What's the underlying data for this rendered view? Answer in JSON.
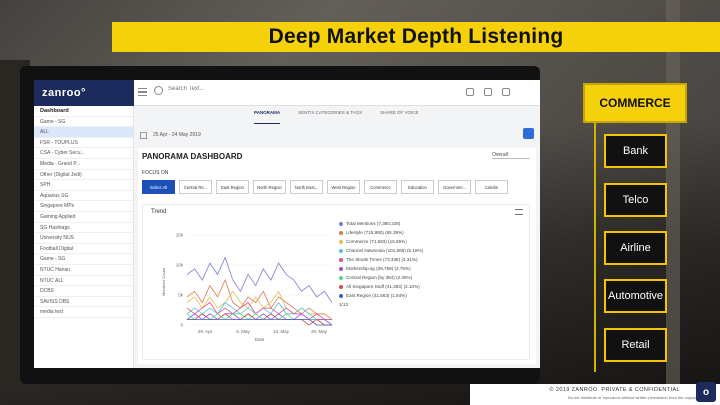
{
  "slide_title": "Deep Market Depth Listening",
  "app": {
    "logo": "zanroo°",
    "search_placeholder": "Search Text...",
    "sidebar": [
      {
        "label": "Dashboard",
        "head": true
      },
      {
        "label": "Game - SG"
      },
      {
        "label": "ALL",
        "active": true
      },
      {
        "label": "FSR - TOUPLUS"
      },
      {
        "label": "CSA - Cyber Secu..."
      },
      {
        "label": "Media - Grand P..."
      },
      {
        "label": "Other (Digital Jedi)"
      },
      {
        "label": "SPH"
      },
      {
        "label": "Aquarius SG"
      },
      {
        "label": "Singapore MPs"
      },
      {
        "label": "Gaming Applied"
      },
      {
        "label": "SG Hashtags"
      },
      {
        "label": "University NUS"
      },
      {
        "label": "Football Digital"
      },
      {
        "label": "Game - SG"
      },
      {
        "label": "NTUC Harian"
      },
      {
        "label": "NTUC ALL"
      },
      {
        "label": "DCBS"
      },
      {
        "label": "SAVISS DBS"
      },
      {
        "label": "media test"
      }
    ],
    "tabs": [
      "PANORAMA",
      "SENTIX CATEGORIES & TAGS",
      "SHARE OF VOICE"
    ],
    "active_tab": "PANORAMA",
    "date_range": "25 Apr - 24 May 2019",
    "dashboard_title": "PANORAMA DASHBOARD",
    "dashboard_select": "Overall",
    "focus_label": "FOCUS ON",
    "focus_buttons": [
      "Select All",
      "Central Re...",
      "East Region",
      "North Region",
      "North East...",
      "West Region",
      "Commerce",
      "Education",
      "Governme...",
      "Celebs"
    ],
    "trend_title": "Trend"
  },
  "chart_data": {
    "type": "line",
    "title": "Trend",
    "xlabel": "Date",
    "ylabel": "Mentions Count",
    "x": [
      "29. Apr",
      "6. May",
      "13. May",
      "20. May"
    ],
    "yticks": [
      "15k",
      "10k",
      "5k",
      "0"
    ],
    "ylim": [
      0,
      16000
    ],
    "series": [
      {
        "name": "Total Mentions (7,380,239)",
        "color": "#7b7bd6",
        "values": [
          9,
          10,
          8,
          11,
          9,
          12,
          8,
          6,
          9,
          7,
          10,
          8,
          11,
          9,
          8,
          6,
          7,
          5,
          6,
          4
        ]
      },
      {
        "name": "Lifestyle (715,880) (65.39%)",
        "color": "#e07a4e",
        "values": [
          5,
          6,
          4,
          7,
          5,
          8,
          4,
          3,
          5,
          4,
          6,
          3,
          5,
          4,
          3,
          2,
          3,
          2,
          2,
          1
        ]
      },
      {
        "name": "Commerce (71,583) (15.55%)",
        "color": "#e0c04e",
        "values": [
          4,
          5,
          3,
          5,
          3,
          4,
          6,
          4,
          3,
          5,
          3,
          4,
          6,
          3,
          2,
          3,
          2,
          2,
          1,
          1
        ]
      },
      {
        "name": "Channel NewsAsia (101,868) (5.18%)",
        "color": "#4ec1e0",
        "values": [
          2,
          3,
          2,
          3,
          2,
          4,
          3,
          2,
          3,
          2,
          3,
          2,
          4,
          2,
          2,
          3,
          2,
          1,
          1,
          1
        ]
      },
      {
        "name": "The Straits Times (73,338) (3.31%)",
        "color": "#e04e8a",
        "values": [
          3,
          2,
          3,
          4,
          2,
          3,
          2,
          3,
          4,
          2,
          3,
          3,
          2,
          3,
          2,
          2,
          1,
          2,
          1,
          1
        ]
      },
      {
        "name": "Mothership.sg (39,758) (2.75%)",
        "color": "#9a4ee0",
        "values": [
          1,
          2,
          1,
          2,
          1,
          2,
          2,
          1,
          2,
          1,
          2,
          1,
          2,
          1,
          1,
          2,
          1,
          1,
          1,
          0
        ]
      },
      {
        "name": "Central Region (by 354) (2.35%)",
        "color": "#4ee07a",
        "values": [
          2,
          1,
          2,
          1,
          2,
          1,
          2,
          2,
          1,
          2,
          1,
          2,
          1,
          2,
          1,
          1,
          1,
          1,
          0,
          0
        ]
      },
      {
        "name": "All Singapore Stuff (41,363) (2.10%)",
        "color": "#d64e4e",
        "values": [
          1,
          1,
          2,
          1,
          1,
          2,
          1,
          1,
          2,
          1,
          1,
          2,
          1,
          1,
          1,
          1,
          0,
          1,
          0,
          0
        ]
      },
      {
        "name": "East Region (41,563) (1.84%)",
        "color": "#3b5fc4",
        "values": [
          1,
          1,
          1,
          1,
          1,
          1,
          1,
          1,
          1,
          1,
          1,
          1,
          1,
          1,
          1,
          1,
          1,
          0,
          0,
          0
        ]
      }
    ],
    "legend_page": "1/13"
  },
  "diagram": {
    "root": "COMMERCE",
    "children": [
      "Bank",
      "Telco",
      "Airline",
      "Automotive",
      "Retail"
    ]
  },
  "footer": {
    "copyright": "© 2019 ZANROO. PRIVATE & CONFIDENTIAL",
    "disclaimer": "Do not distribute or reproduce without written permission from the copyright holder."
  },
  "colors": {
    "accent": "#f5d10b",
    "brand": "#1d2a5c",
    "select": "#1d4fb8"
  }
}
